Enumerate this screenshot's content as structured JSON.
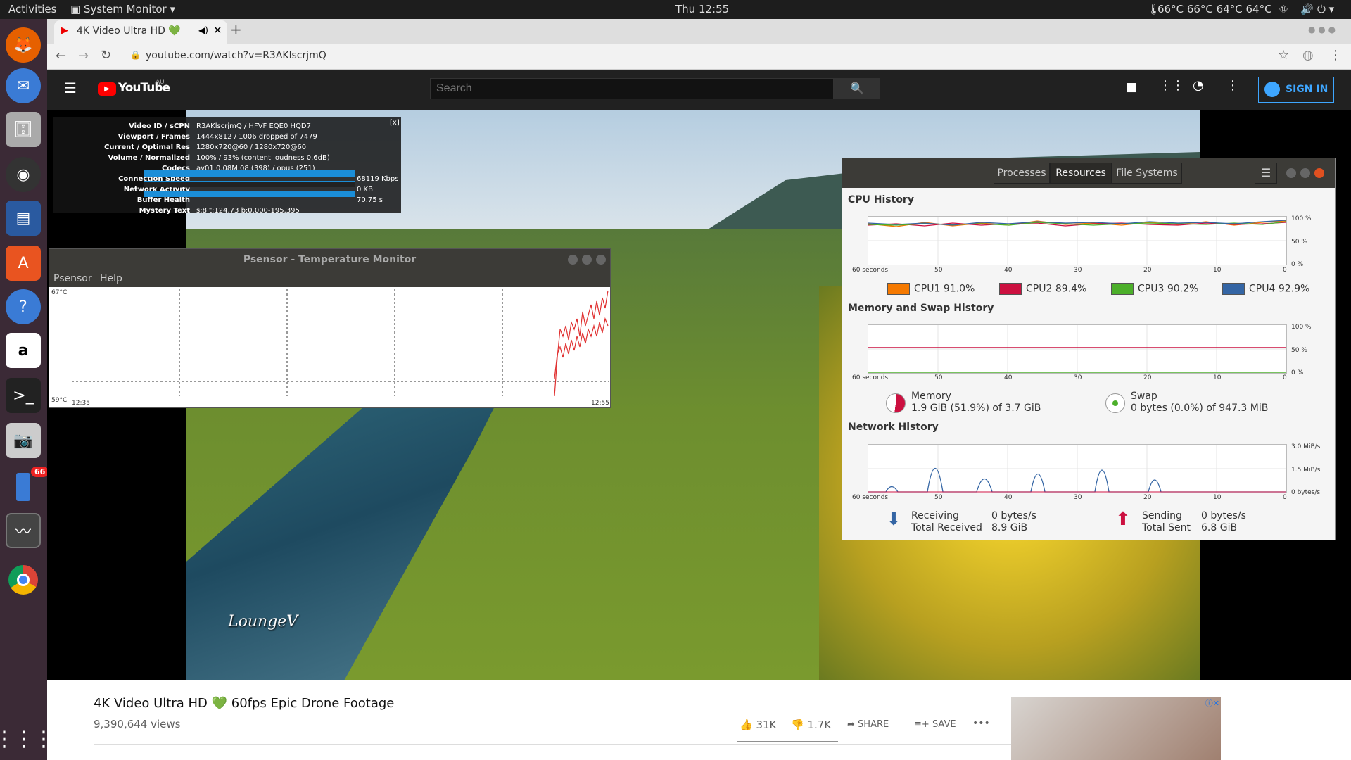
{
  "topbar": {
    "activities": "Activities",
    "app_menu": "System Monitor",
    "clock": "Thu 12:55",
    "temps": "66°C 66°C 64°C 64°C"
  },
  "dock": {
    "badge": "66"
  },
  "browser": {
    "tab_title": "4K Video Ultra HD 💚",
    "new_tab": "+",
    "url": "youtube.com/watch?v=R3AKlscrjmQ"
  },
  "youtube": {
    "logo": "YouTube",
    "region": "AU",
    "search_placeholder": "Search",
    "sign_in": "SIGN IN"
  },
  "stats": {
    "close": "[x]",
    "rows": [
      {
        "label": "Video ID / sCPN",
        "value": "R3AKlscrjmQ / HFVF EQE0 HQD7"
      },
      {
        "label": "Viewport / Frames",
        "value": "1444x812 / 1006 dropped of 7479"
      },
      {
        "label": "Current / Optimal Res",
        "value": "1280x720@60 / 1280x720@60"
      },
      {
        "label": "Volume / Normalized",
        "value": "100% / 93% (content loudness 0.6dB)"
      },
      {
        "label": "Codecs",
        "value": "av01.0.08M.08 (398) / opus (251)"
      },
      {
        "label": "Connection Speed",
        "value": "68119 Kbps"
      },
      {
        "label": "Network Activity",
        "value": "0 KB"
      },
      {
        "label": "Buffer Health",
        "value": "70.75 s"
      },
      {
        "label": "Mystery Text",
        "value": "s:8 t:124.73 b:0.000-195.395"
      }
    ]
  },
  "psensor": {
    "title": "Psensor - Temperature Monitor",
    "menu": [
      "Psensor",
      "Help"
    ],
    "y_max": "67°C",
    "y_min": "59°C",
    "x_start": "12:35",
    "x_end": "12:55"
  },
  "sysmon": {
    "tabs": [
      "Processes",
      "Resources",
      "File Systems"
    ],
    "cpu_title": "CPU History",
    "mem_title": "Memory and Swap History",
    "net_title": "Network History",
    "x_ticks": [
      "60 seconds",
      "50",
      "40",
      "30",
      "20",
      "10",
      "0"
    ],
    "pct_ticks": [
      "100 %",
      "50 %",
      "0 %"
    ],
    "net_ticks": [
      "3.0 MiB/s",
      "1.5 MiB/s",
      "0 bytes/s"
    ],
    "cpus": [
      {
        "name": "CPU1",
        "value": "91.0%",
        "color": "#f57900"
      },
      {
        "name": "CPU2",
        "value": "89.4%",
        "color": "#cc1040"
      },
      {
        "name": "CPU3",
        "value": "90.2%",
        "color": "#4caf2a"
      },
      {
        "name": "CPU4",
        "value": "92.9%",
        "color": "#3465a4"
      }
    ],
    "memory": {
      "label": "Memory",
      "value": "1.9 GiB (51.9%) of 3.7 GiB"
    },
    "swap": {
      "label": "Swap",
      "value": "0 bytes (0.0%) of 947.3 MiB"
    },
    "receiving": {
      "label": "Receiving",
      "rate": "0 bytes/s",
      "total_label": "Total Received",
      "total": "8.9 GiB"
    },
    "sending": {
      "label": "Sending",
      "rate": "0 bytes/s",
      "total_label": "Total Sent",
      "total": "6.8 GiB"
    }
  },
  "video": {
    "watermark": "LoungeV",
    "title": "4K Video Ultra HD 💚 60fps Epic Drone Footage",
    "views": "9,390,644 views",
    "likes": "31K",
    "dislikes": "1.7K",
    "share": "SHARE",
    "save": "SAVE",
    "more": "•••"
  }
}
